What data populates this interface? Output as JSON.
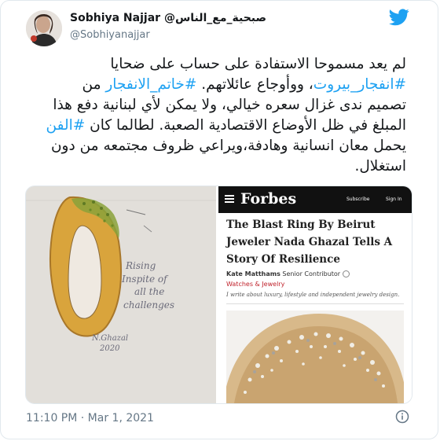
{
  "author": {
    "display_name_en": "Sobhiya Najjar",
    "display_name_ar": "@صبحية_مع_الناس",
    "handle": "@Sobhiyanajjar"
  },
  "tweet": {
    "lines": [
      "لم يعد مسموحا الاستفادة على حساب على ضحايا",
      "، ووأوجاع عائلاتهم.",
      "تصميم ندى غزال سعره خيالي، ولا يمكن لأي لبنانية دفع هذا",
      "المبلغ في ظل الأوضاع الاقتصادية الصعبة. لطالما كان",
      "يحمل معان انسانية وهادفة،ويراعي ظروف مجتمعه من دون",
      "استغلال."
    ],
    "hashtag_beirut": "#انفجار_بيروت",
    "hashtag_ring": "#خاتم_الانفجار",
    "word_min": "من",
    "hashtag_art": "#الفن"
  },
  "media": {
    "sketch": {
      "text_lines": [
        "Rising",
        "Inspite of",
        "all the",
        "challenges"
      ],
      "signature": "N.Ghazal",
      "year": "2020"
    },
    "forbes": {
      "logo": "Forbes",
      "subscribe": "Subscribe",
      "sign_in": "Sign In",
      "headline_lines": [
        "The Blast Ring By Beirut",
        "Jeweler Nada Ghazal Tells A",
        "Story Of Resilience"
      ],
      "author_name": "Kate Matthams",
      "author_role": "Senior Contributor",
      "category": "Watches & Jewelry",
      "description": "I write about luxury, lifestyle and independent jewelry design."
    }
  },
  "timestamp": "11:10 PM · Mar 1, 2021",
  "colors": {
    "link": "#1da1f2",
    "text": "#14171a",
    "muted": "#657786",
    "forbes_red": "#c0232c"
  },
  "icons": {
    "brand": "twitter-bird-icon",
    "info": "info-icon"
  }
}
